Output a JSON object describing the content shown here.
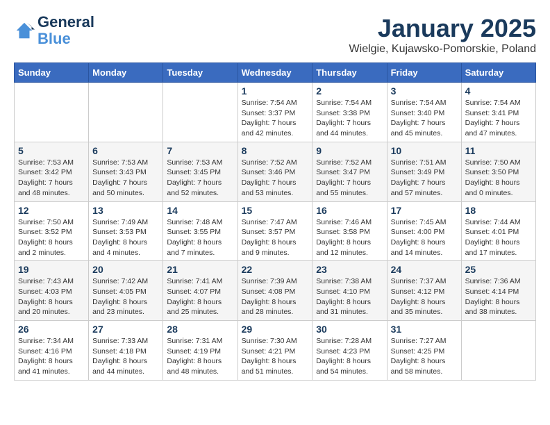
{
  "header": {
    "logo_line1": "General",
    "logo_line2": "Blue",
    "month": "January 2025",
    "location": "Wielgie, Kujawsko-Pomorskie, Poland"
  },
  "weekdays": [
    "Sunday",
    "Monday",
    "Tuesday",
    "Wednesday",
    "Thursday",
    "Friday",
    "Saturday"
  ],
  "weeks": [
    [
      {
        "day": "",
        "info": ""
      },
      {
        "day": "",
        "info": ""
      },
      {
        "day": "",
        "info": ""
      },
      {
        "day": "1",
        "info": "Sunrise: 7:54 AM\nSunset: 3:37 PM\nDaylight: 7 hours\nand 42 minutes."
      },
      {
        "day": "2",
        "info": "Sunrise: 7:54 AM\nSunset: 3:38 PM\nDaylight: 7 hours\nand 44 minutes."
      },
      {
        "day": "3",
        "info": "Sunrise: 7:54 AM\nSunset: 3:40 PM\nDaylight: 7 hours\nand 45 minutes."
      },
      {
        "day": "4",
        "info": "Sunrise: 7:54 AM\nSunset: 3:41 PM\nDaylight: 7 hours\nand 47 minutes."
      }
    ],
    [
      {
        "day": "5",
        "info": "Sunrise: 7:53 AM\nSunset: 3:42 PM\nDaylight: 7 hours\nand 48 minutes."
      },
      {
        "day": "6",
        "info": "Sunrise: 7:53 AM\nSunset: 3:43 PM\nDaylight: 7 hours\nand 50 minutes."
      },
      {
        "day": "7",
        "info": "Sunrise: 7:53 AM\nSunset: 3:45 PM\nDaylight: 7 hours\nand 52 minutes."
      },
      {
        "day": "8",
        "info": "Sunrise: 7:52 AM\nSunset: 3:46 PM\nDaylight: 7 hours\nand 53 minutes."
      },
      {
        "day": "9",
        "info": "Sunrise: 7:52 AM\nSunset: 3:47 PM\nDaylight: 7 hours\nand 55 minutes."
      },
      {
        "day": "10",
        "info": "Sunrise: 7:51 AM\nSunset: 3:49 PM\nDaylight: 7 hours\nand 57 minutes."
      },
      {
        "day": "11",
        "info": "Sunrise: 7:50 AM\nSunset: 3:50 PM\nDaylight: 8 hours\nand 0 minutes."
      }
    ],
    [
      {
        "day": "12",
        "info": "Sunrise: 7:50 AM\nSunset: 3:52 PM\nDaylight: 8 hours\nand 2 minutes."
      },
      {
        "day": "13",
        "info": "Sunrise: 7:49 AM\nSunset: 3:53 PM\nDaylight: 8 hours\nand 4 minutes."
      },
      {
        "day": "14",
        "info": "Sunrise: 7:48 AM\nSunset: 3:55 PM\nDaylight: 8 hours\nand 7 minutes."
      },
      {
        "day": "15",
        "info": "Sunrise: 7:47 AM\nSunset: 3:57 PM\nDaylight: 8 hours\nand 9 minutes."
      },
      {
        "day": "16",
        "info": "Sunrise: 7:46 AM\nSunset: 3:58 PM\nDaylight: 8 hours\nand 12 minutes."
      },
      {
        "day": "17",
        "info": "Sunrise: 7:45 AM\nSunset: 4:00 PM\nDaylight: 8 hours\nand 14 minutes."
      },
      {
        "day": "18",
        "info": "Sunrise: 7:44 AM\nSunset: 4:01 PM\nDaylight: 8 hours\nand 17 minutes."
      }
    ],
    [
      {
        "day": "19",
        "info": "Sunrise: 7:43 AM\nSunset: 4:03 PM\nDaylight: 8 hours\nand 20 minutes."
      },
      {
        "day": "20",
        "info": "Sunrise: 7:42 AM\nSunset: 4:05 PM\nDaylight: 8 hours\nand 23 minutes."
      },
      {
        "day": "21",
        "info": "Sunrise: 7:41 AM\nSunset: 4:07 PM\nDaylight: 8 hours\nand 25 minutes."
      },
      {
        "day": "22",
        "info": "Sunrise: 7:39 AM\nSunset: 4:08 PM\nDaylight: 8 hours\nand 28 minutes."
      },
      {
        "day": "23",
        "info": "Sunrise: 7:38 AM\nSunset: 4:10 PM\nDaylight: 8 hours\nand 31 minutes."
      },
      {
        "day": "24",
        "info": "Sunrise: 7:37 AM\nSunset: 4:12 PM\nDaylight: 8 hours\nand 35 minutes."
      },
      {
        "day": "25",
        "info": "Sunrise: 7:36 AM\nSunset: 4:14 PM\nDaylight: 8 hours\nand 38 minutes."
      }
    ],
    [
      {
        "day": "26",
        "info": "Sunrise: 7:34 AM\nSunset: 4:16 PM\nDaylight: 8 hours\nand 41 minutes."
      },
      {
        "day": "27",
        "info": "Sunrise: 7:33 AM\nSunset: 4:18 PM\nDaylight: 8 hours\nand 44 minutes."
      },
      {
        "day": "28",
        "info": "Sunrise: 7:31 AM\nSunset: 4:19 PM\nDaylight: 8 hours\nand 48 minutes."
      },
      {
        "day": "29",
        "info": "Sunrise: 7:30 AM\nSunset: 4:21 PM\nDaylight: 8 hours\nand 51 minutes."
      },
      {
        "day": "30",
        "info": "Sunrise: 7:28 AM\nSunset: 4:23 PM\nDaylight: 8 hours\nand 54 minutes."
      },
      {
        "day": "31",
        "info": "Sunrise: 7:27 AM\nSunset: 4:25 PM\nDaylight: 8 hours\nand 58 minutes."
      },
      {
        "day": "",
        "info": ""
      }
    ]
  ]
}
